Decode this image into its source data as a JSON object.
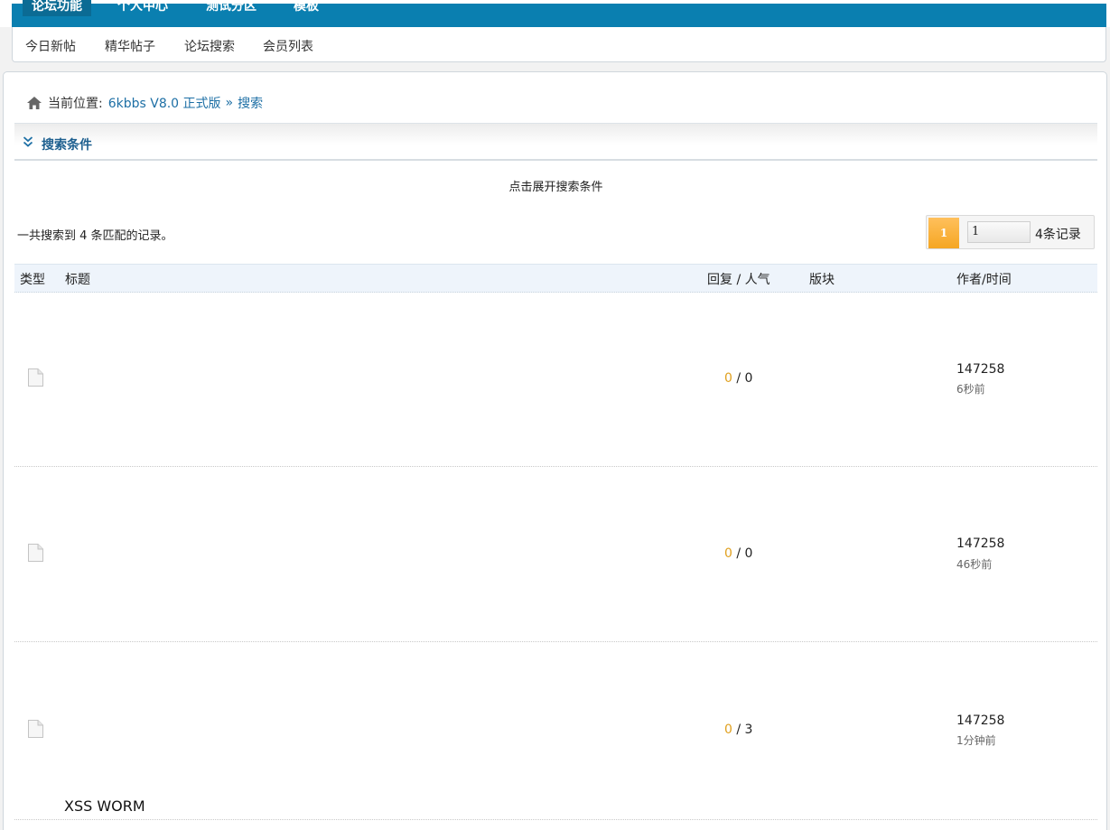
{
  "topnav": {
    "tabs": [
      "论坛功能",
      "个人中心",
      "测试分区",
      "模板"
    ]
  },
  "subnav": {
    "items": [
      "今日新帖",
      "精华帖子",
      "论坛搜索",
      "会员列表"
    ]
  },
  "breadcrumb": {
    "prefix": "当前位置:",
    "forum": "6kbbs V8.0 正式版",
    "separator": "»",
    "current": "搜索"
  },
  "search_panel": {
    "title": "搜索条件",
    "expand_text": "点击展开搜索条件"
  },
  "results": {
    "summary": "一共搜索到 4 条匹配的记录。"
  },
  "pager": {
    "current_page": "1",
    "page_input_value": "1",
    "total": "4条记录"
  },
  "table": {
    "headers": {
      "type": "类型",
      "title": "标题",
      "counts": "回复 / 人气",
      "board": "版块",
      "author_time": "作者/时间"
    },
    "rows": [
      {
        "title": "",
        "replies": "0",
        "separator": " / ",
        "views": "0",
        "author": "147258",
        "time": "6秒前"
      },
      {
        "title": "",
        "replies": "0",
        "separator": " / ",
        "views": "0",
        "author": "147258",
        "time": "46秒前"
      },
      {
        "title": "",
        "replies": "0",
        "separator": " / ",
        "views": "3",
        "author": "147258",
        "time": "1分钟前"
      },
      {
        "title": "XSS WORM"
      }
    ]
  },
  "colors": {
    "nav_blue": "#0a7fb0",
    "link_blue": "#1d6fa5",
    "accent_orange": "#f5a623",
    "reply_count": "#e0a01e"
  }
}
